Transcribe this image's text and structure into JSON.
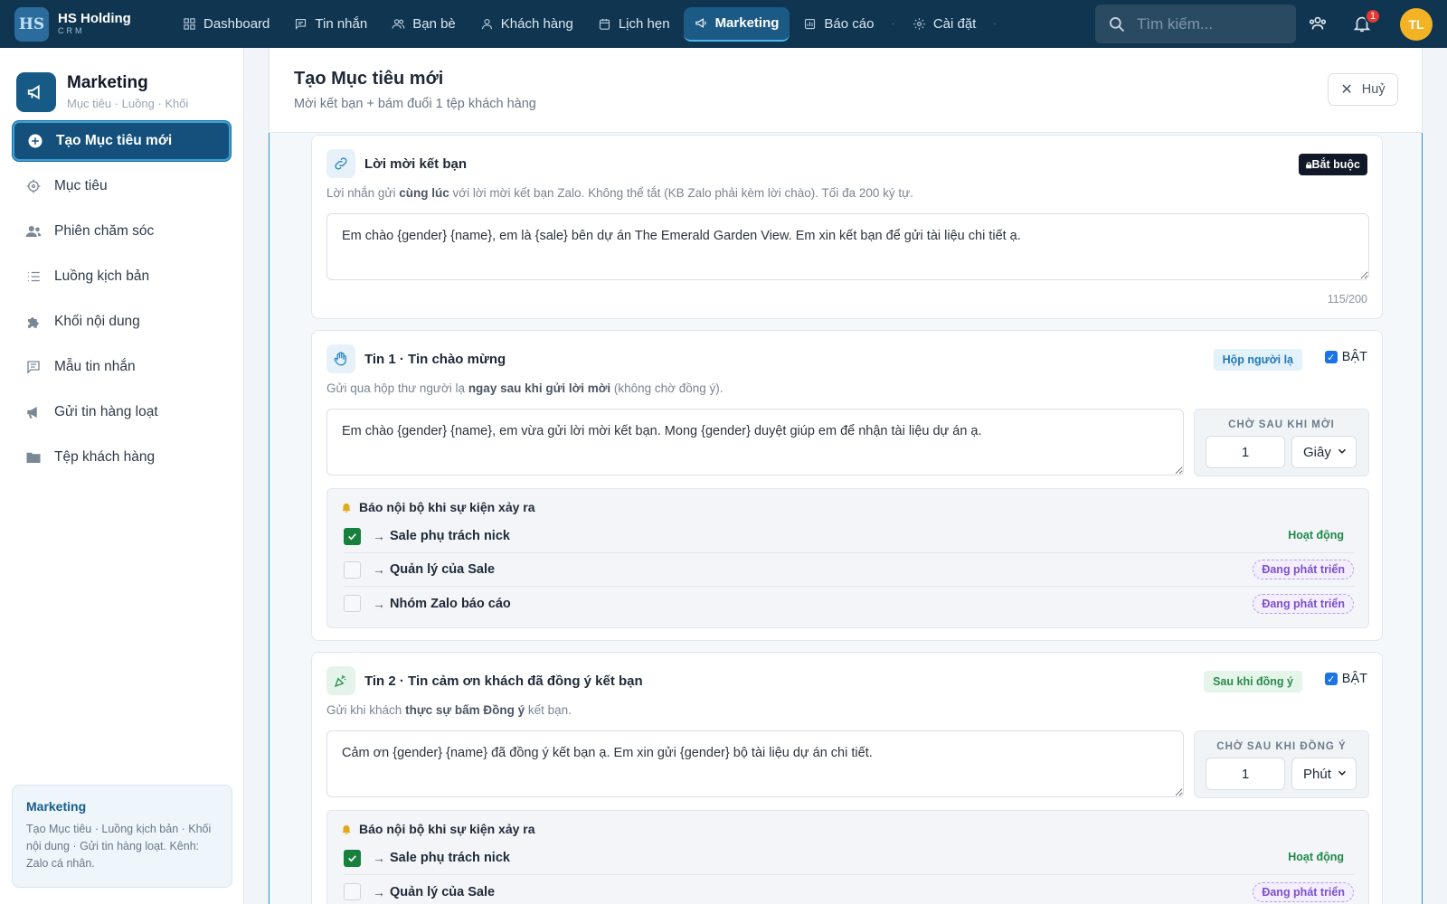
{
  "brand": {
    "logo_text": "HS",
    "name": "HS Holding",
    "sub": "CRM"
  },
  "nav": {
    "items": [
      {
        "label": "Dashboard",
        "icon": "grid-icon"
      },
      {
        "label": "Tin nhắn",
        "icon": "message-icon"
      },
      {
        "label": "Bạn bè",
        "icon": "users-icon"
      },
      {
        "label": "Khách hàng",
        "icon": "user-icon"
      },
      {
        "label": "Lịch hẹn",
        "icon": "calendar-icon"
      },
      {
        "label": "Marketing",
        "icon": "megaphone-icon",
        "active": true
      },
      {
        "label": "Báo cáo",
        "icon": "chart-icon"
      },
      {
        "label": "Cài đặt",
        "icon": "gear-icon"
      }
    ],
    "separator": "·"
  },
  "search": {
    "placeholder": "Tìm kiếm...",
    "value": ""
  },
  "notifications": {
    "count": "1"
  },
  "user": {
    "initials": "TL"
  },
  "colors": {
    "topbar": "#0f3550",
    "accent": "#14507b",
    "active_green": "#16803c",
    "dev_purple": "#7c4fd1"
  },
  "sidebar": {
    "title": "Marketing",
    "subtitle": "Mục tiêu · Luồng · Khối",
    "items": [
      {
        "label": "Tạo Mục tiêu mới",
        "icon": "plus-circle-icon",
        "active": true
      },
      {
        "label": "Mục tiêu",
        "icon": "target-icon"
      },
      {
        "label": "Phiên chăm sóc",
        "icon": "user-group-icon"
      },
      {
        "label": "Luồng kịch bản",
        "icon": "list-icon"
      },
      {
        "label": "Khối nội dung",
        "icon": "puzzle-icon"
      },
      {
        "label": "Mẫu tin nhắn",
        "icon": "chat-template-icon"
      },
      {
        "label": "Gửi tin hàng loạt",
        "icon": "bullhorn-icon"
      },
      {
        "label": "Tệp khách hàng",
        "icon": "folder-user-icon"
      }
    ],
    "info": {
      "title": "Marketing",
      "text": "Tạo Mục tiêu · Luồng kịch bản · Khối nội dung · Gửi tin hàng loạt. Kênh: Zalo cá nhân."
    }
  },
  "page": {
    "title": "Tạo Mục tiêu mới",
    "subtitle": "Mời kết bạn + bám đuổi 1 tệp khách hàng",
    "cancel_label": "Huỷ"
  },
  "invite_card": {
    "title": "Lời mời kết bạn",
    "badge": "Bắt buộc",
    "desc_pre": "Lời nhắn gửi ",
    "desc_bold": "cùng lúc",
    "desc_post": " với lời mời kết bạn Zalo. Không thể tắt (KB Zalo phải kèm lời chào). Tối đa 200 ký tự.",
    "message": "Em chào {gender} {name}, em là {sale} bên dự án The Emerald Garden View. Em xin kết bạn để gửi tài liệu chi tiết ạ.",
    "counter": "115/200"
  },
  "msg1_card": {
    "title": "Tin 1 · Tin chào mừng",
    "tag": "Hộp người lạ",
    "toggle_label": "BẬT",
    "desc_pre": "Gửi qua hộp thư người lạ ",
    "desc_bold": "ngay sau khi gửi lời mời",
    "desc_post": " (không chờ đồng ý).",
    "message": "Em chào {gender} {name}, em vừa gửi lời mời kết bạn. Mong {gender} duyệt giúp em để nhận tài liệu dự án ạ.",
    "delay_label": "CHỜ SAU KHI MỜI",
    "delay_value": "1",
    "delay_unit": "Giây",
    "notify_title": "Báo nội bộ khi sự kiện xảy ra",
    "notify_rows": [
      {
        "arrow": "→",
        "label": "Sale phụ trách nick",
        "status": "Hoạt động"
      },
      {
        "arrow": "→",
        "label": "Quản lý của Sale",
        "status": "Đang phát triển"
      },
      {
        "arrow": "→",
        "label": "Nhóm Zalo báo cáo",
        "status": "Đang phát triển"
      }
    ]
  },
  "msg2_card": {
    "title": "Tin 2 · Tin cảm ơn khách đã đồng ý kết bạn",
    "tag": "Sau khi đồng ý",
    "toggle_label": "BẬT",
    "desc_pre": "Gửi khi khách ",
    "desc_bold": "thực sự bấm Đồng ý",
    "desc_post": " kết bạn.",
    "message": "Cảm ơn {gender} {name} đã đồng ý kết bạn ạ. Em xin gửi {gender} bộ tài liệu dự án chi tiết.",
    "delay_label": "CHỜ SAU KHI ĐỒNG Ý",
    "delay_value": "1",
    "delay_unit": "Phút",
    "notify_title": "Báo nội bộ khi sự kiện xảy ra",
    "notify_rows": [
      {
        "arrow": "→",
        "label": "Sale phụ trách nick",
        "status": "Hoạt động"
      },
      {
        "arrow": "→",
        "label": "Quản lý của Sale",
        "status": "Đang phát triển"
      }
    ]
  }
}
